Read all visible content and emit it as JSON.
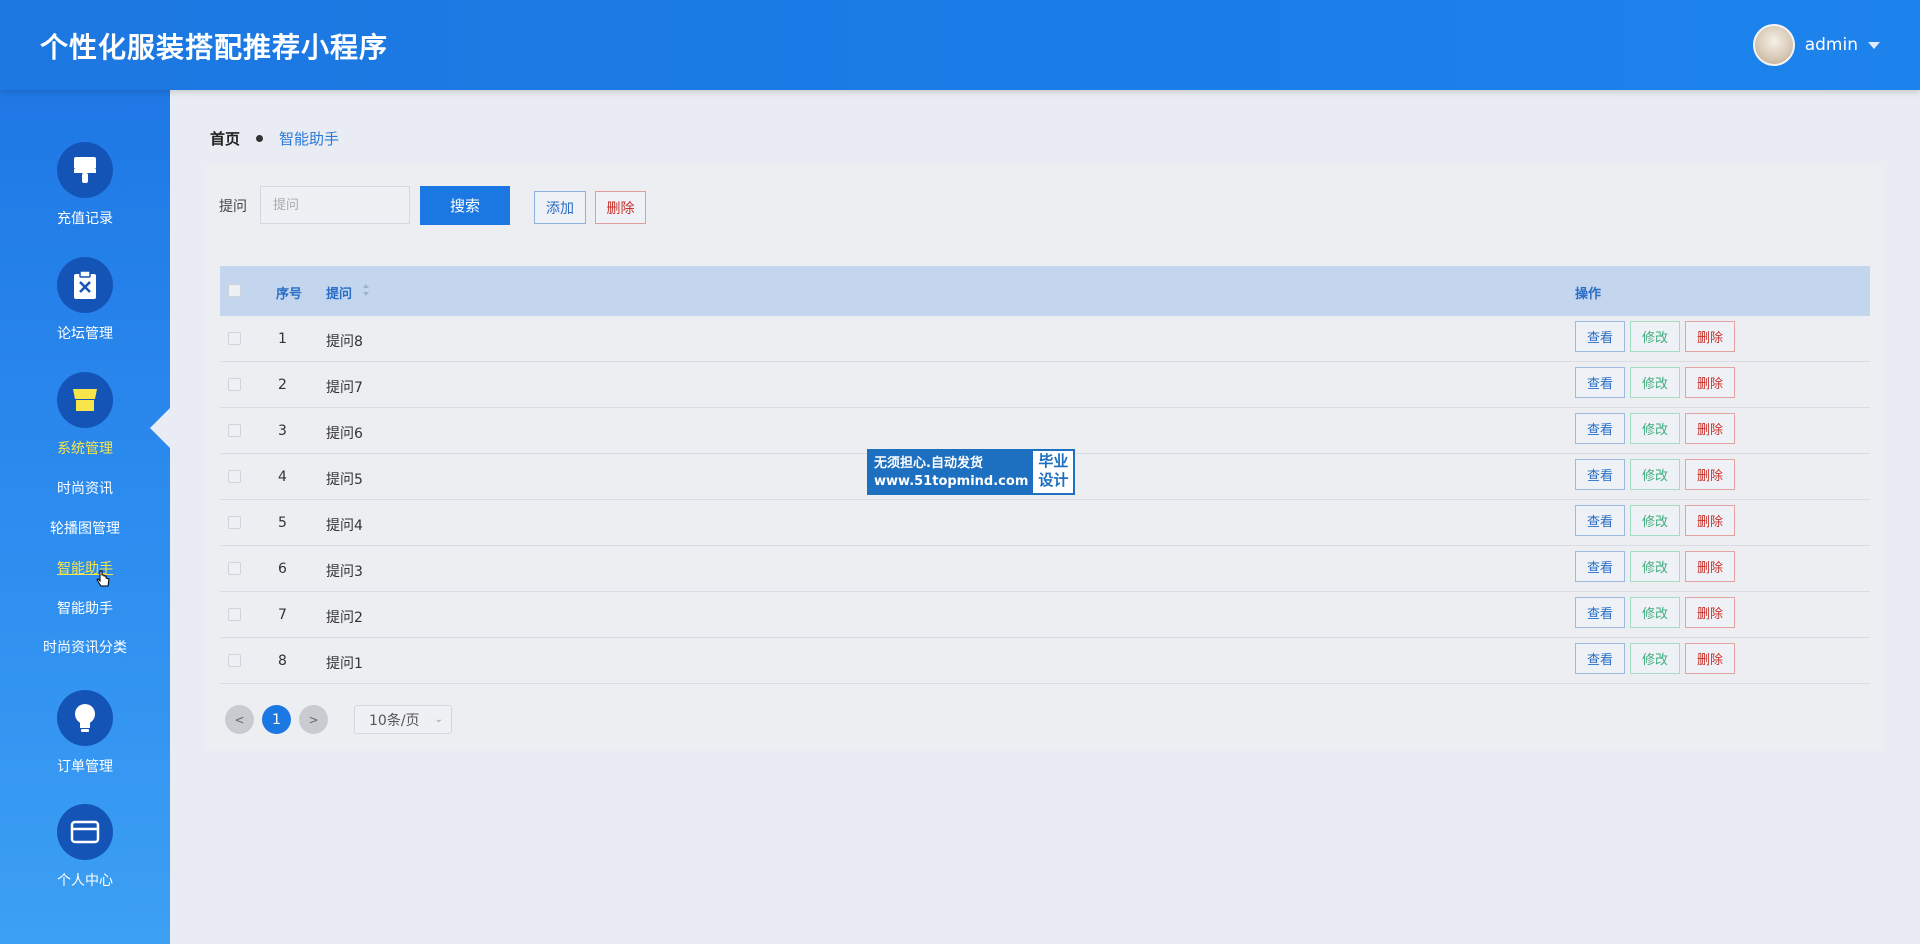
{
  "header": {
    "title": "个性化服装搭配推荐小程序",
    "user": "admin"
  },
  "sidebar": {
    "groups": [
      {
        "label": "充值记录",
        "icon": "brush-icon"
      },
      {
        "label": "论坛管理",
        "icon": "clipboard-x-icon"
      },
      {
        "label": "系统管理",
        "icon": "shop-icon",
        "active": true
      },
      {
        "label": "订单管理",
        "icon": "lightbulb-icon"
      },
      {
        "label": "个人中心",
        "icon": "wallet-icon"
      }
    ],
    "sub_items": [
      "时尚资讯",
      "轮播图管理",
      "智能助手",
      "智能助手",
      "时尚资讯分类"
    ]
  },
  "breadcrumb": {
    "home": "首页",
    "current": "智能助手"
  },
  "search": {
    "label": "提问",
    "placeholder": "提问",
    "search_button": "搜索",
    "add_button": "添加",
    "delete_button": "删除"
  },
  "table": {
    "headers": {
      "index": "序号",
      "question": "提问",
      "actions": "操作"
    },
    "rows": [
      {
        "index": "1",
        "question": "提问8"
      },
      {
        "index": "2",
        "question": "提问7"
      },
      {
        "index": "3",
        "question": "提问6"
      },
      {
        "index": "4",
        "question": "提问5"
      },
      {
        "index": "5",
        "question": "提问4"
      },
      {
        "index": "6",
        "question": "提问3"
      },
      {
        "index": "7",
        "question": "提问2"
      },
      {
        "index": "8",
        "question": "提问1"
      }
    ],
    "row_actions": {
      "view": "查看",
      "edit": "修改",
      "delete": "删除"
    }
  },
  "pagination": {
    "prev": "<",
    "next": ">",
    "current_page": "1",
    "page_size": "10条/页"
  },
  "watermark": {
    "line1": "无须担心.自动发货",
    "line2": "www.51topmind.com",
    "badge1": "毕业",
    "badge2": "设计"
  },
  "colors": {
    "header": "#1d77e0",
    "sidebar_icon_bg": "#1554b7",
    "active": "#f7e54a",
    "primary": "#1b78e2"
  }
}
